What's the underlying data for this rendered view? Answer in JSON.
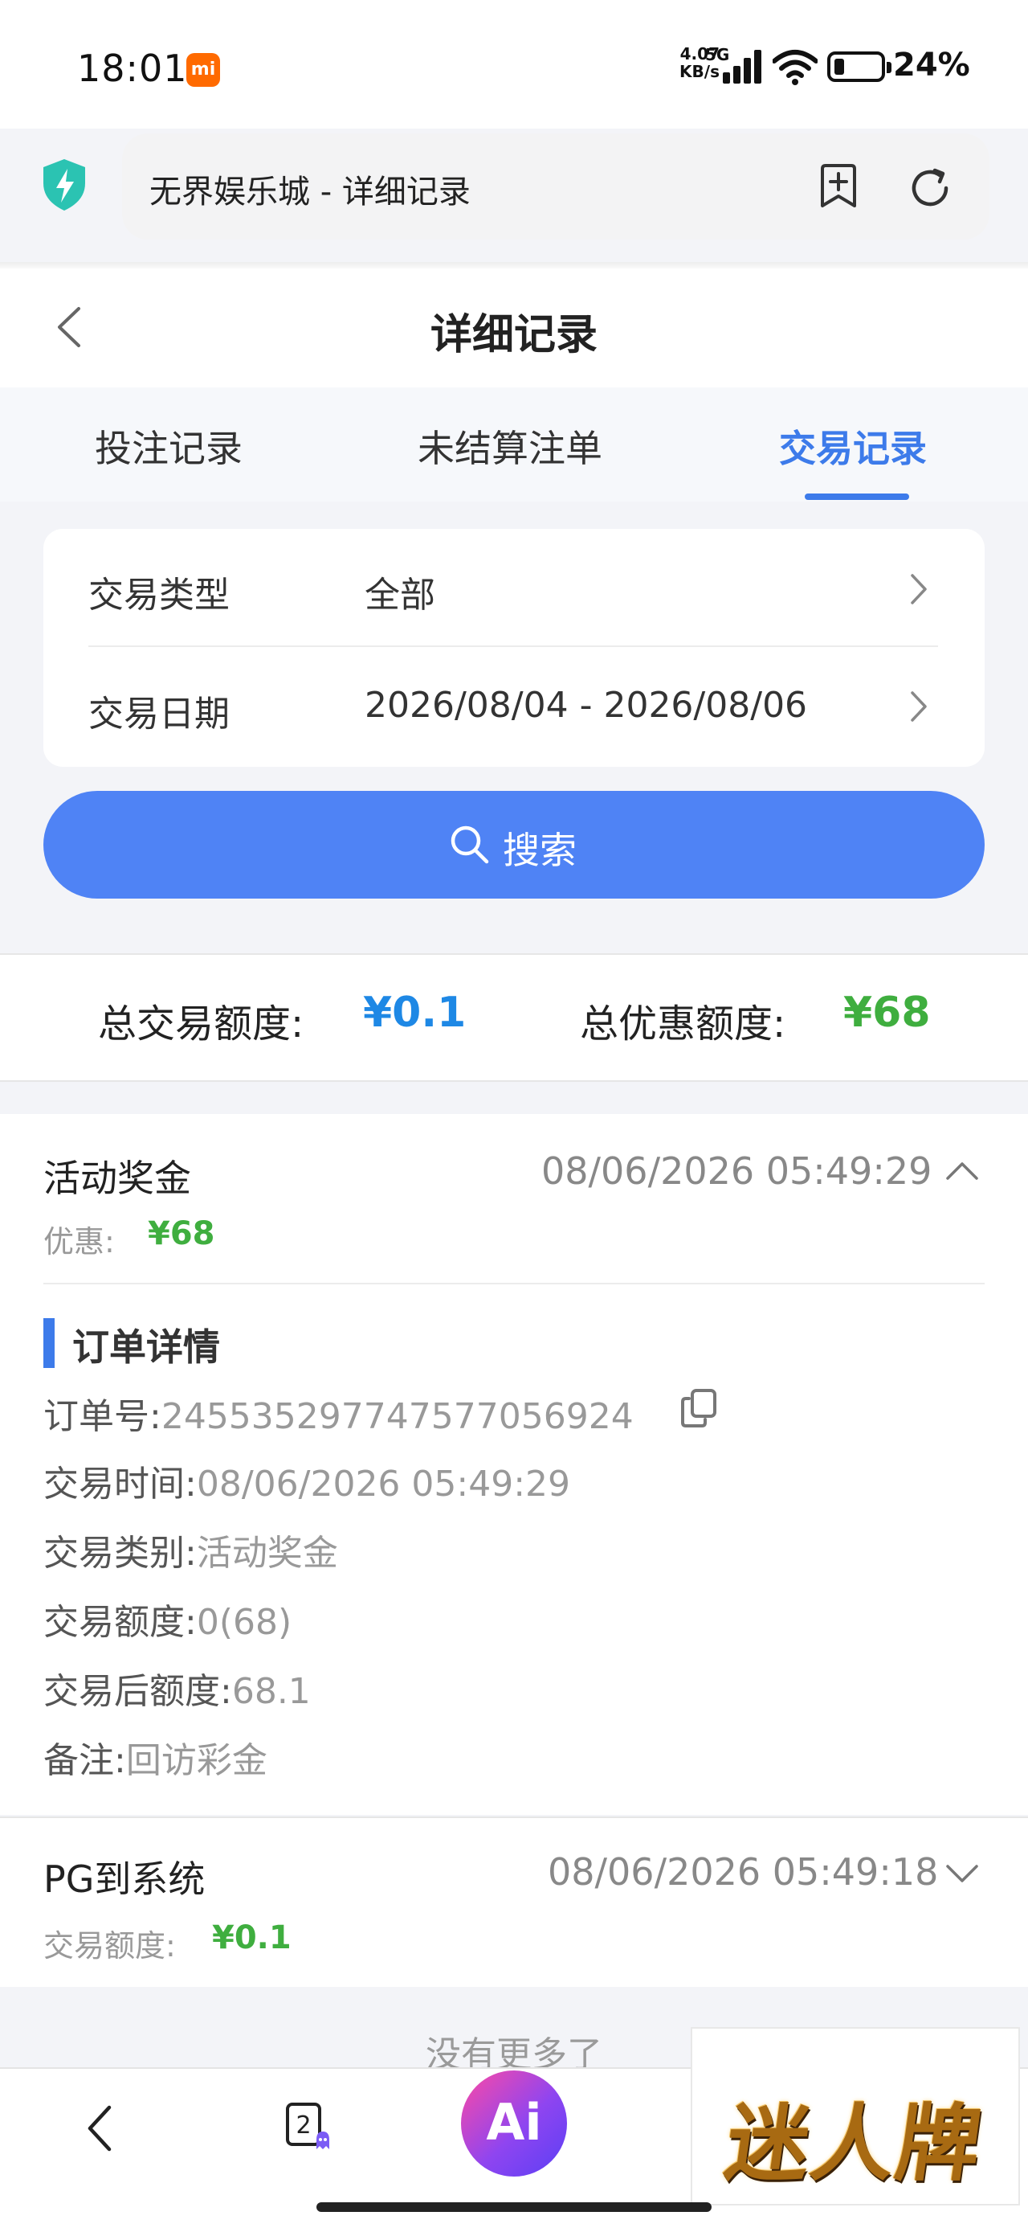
{
  "status_bar": {
    "time": "18:01",
    "carrier_badge": "mi",
    "net_speed": "4.07\nKB/s",
    "network": "5G",
    "battery": "24%"
  },
  "browser": {
    "address_title": "无界娱乐城 - 详细记录",
    "icons": [
      "shield-lightning-icon",
      "bookmark-add-icon",
      "reload-icon"
    ]
  },
  "header": {
    "title": "详细记录"
  },
  "tabs": [
    {
      "label": "投注记录",
      "active": false
    },
    {
      "label": "未结算注单",
      "active": false
    },
    {
      "label": "交易记录",
      "active": true
    }
  ],
  "filters": {
    "type_label": "交易类型",
    "type_value": "全部",
    "date_label": "交易日期",
    "date_value": "2026/08/04 - 2026/08/06"
  },
  "search": {
    "label": "搜索"
  },
  "totals": {
    "trade_label": "总交易额度:",
    "trade_value": "¥0.1",
    "promo_label": "总优惠额度:",
    "promo_value": "¥68",
    "trade_color": "#1e88e5",
    "promo_color": "#3fae3f"
  },
  "records": [
    {
      "title": "活动奖金",
      "time": "08/06/2026 05:49:29",
      "sub_label": "优惠:",
      "sub_value": "¥68",
      "expanded": true,
      "details": {
        "heading": "订单详情",
        "order_no_label": "订单号:",
        "order_no": "245535297747577056924",
        "trade_time_label": "交易时间:",
        "trade_time": "08/06/2026 05:49:29",
        "trade_type_label": "交易类别:",
        "trade_type": "活动奖金",
        "amount_label": "交易额度:",
        "amount": "0(68)",
        "after_label": "交易后额度:",
        "after": "68.1",
        "note_label": "备注:",
        "note": "回访彩金"
      }
    },
    {
      "title": "PG到系统",
      "time": "08/06/2026 05:49:18",
      "sub_label": "交易额度:",
      "sub_value": "¥0.1",
      "expanded": false
    }
  ],
  "no_more": "没有更多了",
  "bottom_nav": {
    "tabs_count": "2",
    "ai_label": "Ai",
    "watermark": "迷人牌"
  }
}
